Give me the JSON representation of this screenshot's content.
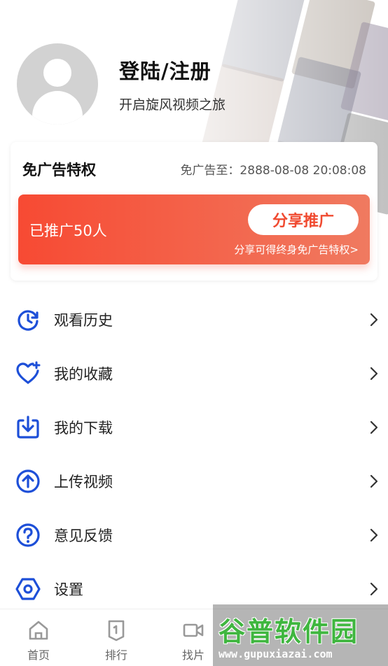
{
  "profile": {
    "title": "登陆/注册",
    "subtitle": "开启旋风视频之旅"
  },
  "ad_free": {
    "title": "免广告特权",
    "expire": "免广告至：2888-08-08 20:08:08",
    "promo_count": "已推广50人",
    "share_button": "分享推广",
    "promo_note": "分享可得终身免广告特权>"
  },
  "menu": [
    {
      "label": "观看历史",
      "icon": "history-icon"
    },
    {
      "label": "我的收藏",
      "icon": "favorite-heart-icon"
    },
    {
      "label": "我的下载",
      "icon": "download-icon"
    },
    {
      "label": "上传视频",
      "icon": "upload-icon"
    },
    {
      "label": "意见反馈",
      "icon": "feedback-question-icon"
    },
    {
      "label": "设置",
      "icon": "settings-icon"
    }
  ],
  "tabbar": [
    {
      "label": "首页",
      "icon": "home-icon"
    },
    {
      "label": "排行",
      "icon": "ranking-icon"
    },
    {
      "label": "找片",
      "icon": "video-camera-icon"
    }
  ],
  "watermark": {
    "title": "谷普软件园",
    "url": "www.gupuxiazai.com"
  },
  "colors": {
    "accent_blue": "#1d4fd8",
    "promo_red": "#f74a33",
    "avatar_gray": "#d2d2d2"
  }
}
